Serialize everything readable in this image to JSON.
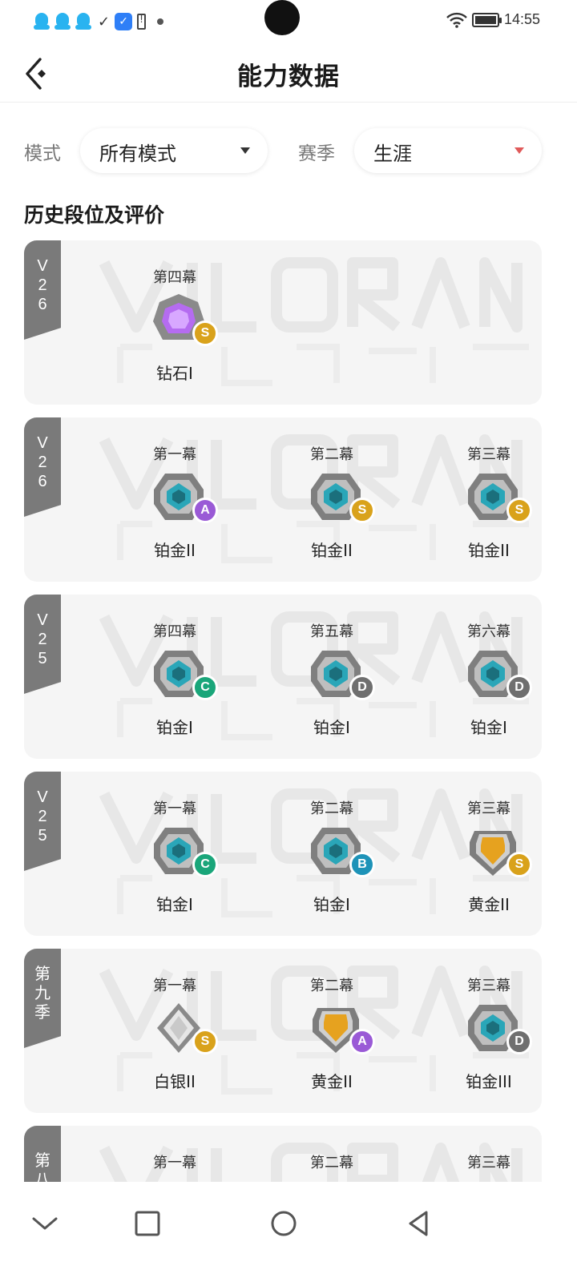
{
  "status_bar": {
    "time": "14:55",
    "icons": [
      "qq-icon",
      "qq-icon",
      "qq-icon",
      "check-icon",
      "shield-app-icon",
      "battery-alert-icon",
      "dot-icon",
      "wifi-icon",
      "battery-icon"
    ]
  },
  "header": {
    "title": "能力数据",
    "back_icon": "back-arrow-icon"
  },
  "filters": {
    "mode_label": "模式",
    "mode_value": "所有模式",
    "season_label": "赛季",
    "season_value": "生涯"
  },
  "section": {
    "title": "历史段位及评价"
  },
  "colors": {
    "grade_S": "#d9a21b",
    "grade_A": "#9a5ad6",
    "grade_B": "#1e93b8",
    "grade_C": "#1aa67a",
    "grade_D": "#6f6f6f",
    "diamond": "#b56cf0",
    "platinum": "#2aa6b8",
    "gold": "#e6a21f",
    "silver": "#c9c9c9",
    "tag": "#7a7a7a"
  },
  "cards": [
    {
      "season_tag": [
        "V",
        "2",
        "6"
      ],
      "acts": [
        {
          "act": "第四幕",
          "rank": "钻石I",
          "tier": "diamond",
          "grade": "S"
        }
      ]
    },
    {
      "season_tag": [
        "V",
        "2",
        "6"
      ],
      "acts": [
        {
          "act": "第一幕",
          "rank": "铂金II",
          "tier": "platinum",
          "grade": "A"
        },
        {
          "act": "第二幕",
          "rank": "铂金II",
          "tier": "platinum",
          "grade": "S"
        },
        {
          "act": "第三幕",
          "rank": "铂金II",
          "tier": "platinum",
          "grade": "S"
        }
      ]
    },
    {
      "season_tag": [
        "V",
        "2",
        "5"
      ],
      "acts": [
        {
          "act": "第四幕",
          "rank": "铂金I",
          "tier": "platinum",
          "grade": "C"
        },
        {
          "act": "第五幕",
          "rank": "铂金I",
          "tier": "platinum",
          "grade": "D"
        },
        {
          "act": "第六幕",
          "rank": "铂金I",
          "tier": "platinum",
          "grade": "D"
        }
      ]
    },
    {
      "season_tag": [
        "V",
        "2",
        "5"
      ],
      "acts": [
        {
          "act": "第一幕",
          "rank": "铂金I",
          "tier": "platinum",
          "grade": "C"
        },
        {
          "act": "第二幕",
          "rank": "铂金I",
          "tier": "platinum",
          "grade": "B"
        },
        {
          "act": "第三幕",
          "rank": "黄金II",
          "tier": "gold",
          "grade": "S"
        }
      ]
    },
    {
      "season_tag": [
        "第",
        "九",
        "季"
      ],
      "acts": [
        {
          "act": "第一幕",
          "rank": "白银II",
          "tier": "silver",
          "grade": "S"
        },
        {
          "act": "第二幕",
          "rank": "黄金II",
          "tier": "gold",
          "grade": "A"
        },
        {
          "act": "第三幕",
          "rank": "铂金III",
          "tier": "platinum",
          "grade": "D"
        }
      ]
    },
    {
      "season_tag": [
        "第",
        "八"
      ],
      "acts": [
        {
          "act": "第一幕",
          "rank": "",
          "tier": "platinum",
          "grade": ""
        },
        {
          "act": "第二幕",
          "rank": "",
          "tier": "platinum",
          "grade": ""
        },
        {
          "act": "第三幕",
          "rank": "",
          "tier": "platinum",
          "grade": ""
        }
      ]
    }
  ],
  "nav_bar": {
    "buttons": [
      "collapse-icon",
      "recents-icon",
      "home-icon",
      "back-icon"
    ]
  }
}
